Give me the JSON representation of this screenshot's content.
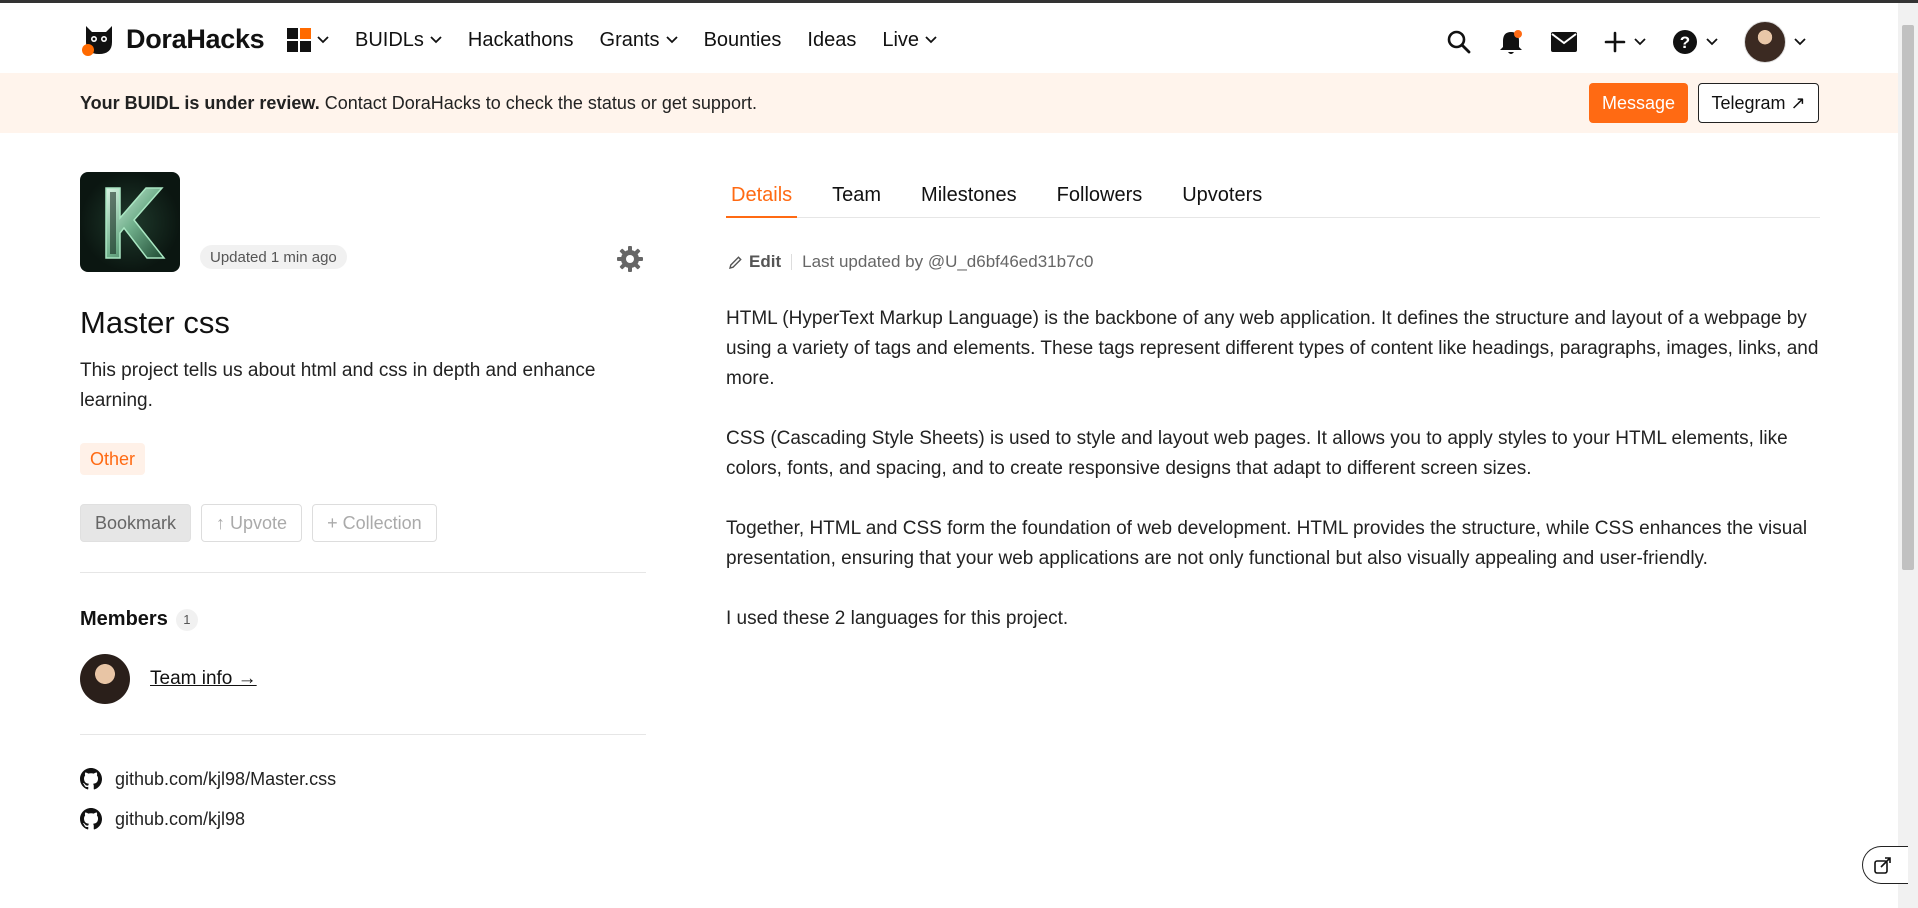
{
  "header": {
    "brand": "DoraHacks",
    "nav": [
      {
        "label": "BUIDLs",
        "has_dropdown": true
      },
      {
        "label": "Hackathons",
        "has_dropdown": false
      },
      {
        "label": "Grants",
        "has_dropdown": true
      },
      {
        "label": "Bounties",
        "has_dropdown": false
      },
      {
        "label": "Ideas",
        "has_dropdown": false
      },
      {
        "label": "Live",
        "has_dropdown": true
      }
    ],
    "accent_color": "#ff6a13"
  },
  "banner": {
    "bold_text": "Your BUIDL is under review.",
    "text": " Contact DoraHacks to check the status or get support.",
    "message_label": "Message",
    "telegram_label": "Telegram ↗"
  },
  "project": {
    "updated": "Updated 1 min ago",
    "title": "Master css",
    "description": "This project tells us about html and css in depth and enhance learning.",
    "tag": "Other",
    "bookmark_label": "Bookmark",
    "upvote_label": "↑ Upvote",
    "collection_label": "+ Collection",
    "members_label": "Members",
    "members_count": "1",
    "team_info_label": "Team info →",
    "links": [
      "github.com/kjl98/Master.css",
      "github.com/kjl98"
    ]
  },
  "tabs": [
    "Details",
    "Team",
    "Milestones",
    "Followers",
    "Upvoters"
  ],
  "details": {
    "edit_label": "Edit",
    "last_updated": "Last updated by @U_d6bf46ed31b7c0",
    "paragraphs": [
      "HTML (HyperText Markup Language) is the backbone of any web application. It defines the structure and layout of a webpage by using a variety of tags and elements. These tags represent different types of content like headings, paragraphs, images, links, and more.",
      "CSS (Cascading Style Sheets) is used to style and layout web pages. It allows you to apply styles to your HTML elements, like colors, fonts, and spacing, and to create responsive designs that adapt to different screen sizes.",
      "Together, HTML and CSS form the foundation of web development. HTML provides the structure, while CSS enhances the visual presentation, ensuring that your web applications are not only functional but also visually appealing and user-friendly.",
      "I used these 2 languages for this project."
    ]
  }
}
